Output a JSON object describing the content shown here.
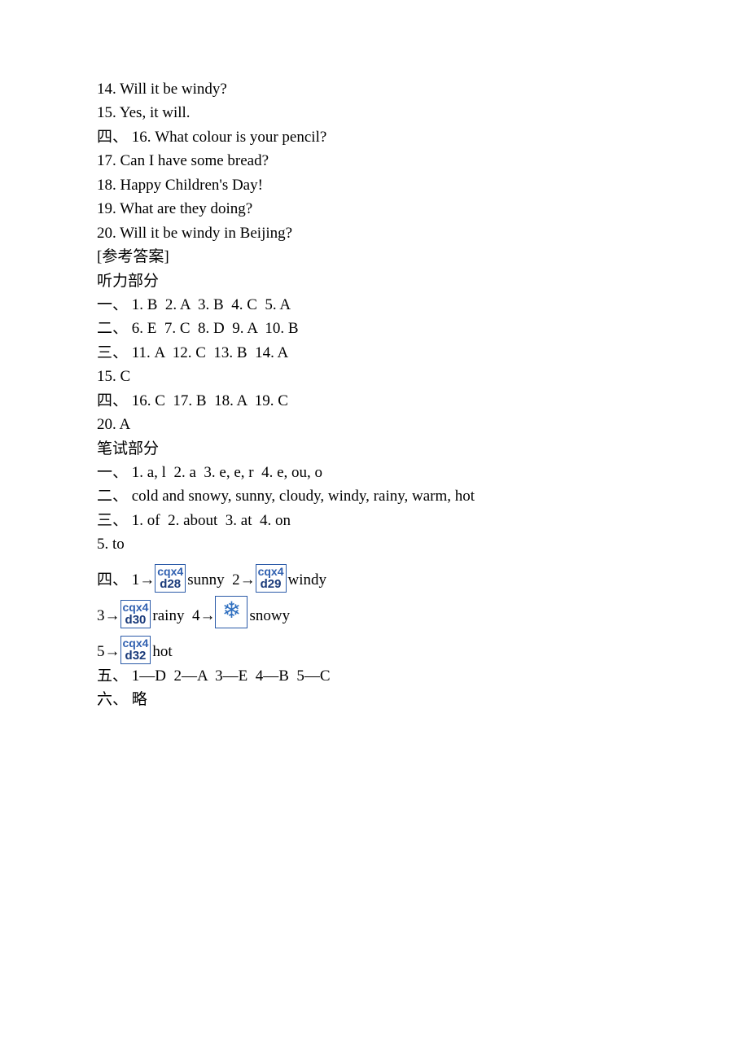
{
  "lines": {
    "l1": "14. Will it be windy?",
    "l2": "15. Yes, it will.",
    "l3": "四、 16. What colour is your pencil?",
    "l4": "17. Can I have some bread?",
    "l5": "18. Happy Children's Day!",
    "l6": "19. What are they doing?",
    "l7": "20. Will it be windy in Beijing?",
    "l8": "[参考答案]",
    "l9": "听力部分",
    "l10": "一、 1. B  2. A  3. B  4. C  5. A",
    "l11": "二、 6. E  7. C  8. D  9. A  10. B",
    "l12": "三、 11. A  12. C  13. B  14. A",
    "l13": "15. C",
    "l14": "四、 16. C  17. B  18. A  19. C",
    "l15": "20. A",
    "l16": "笔试部分",
    "l17": "一、 1. a, l  2. a  3. e, e, r  4. e, ou, o",
    "l18": "二、 cold and snowy, sunny, cloudy, windy, rainy, warm, hot",
    "l19": "三、 1. of  2. about  3. at  4. on",
    "l20": "5. to",
    "l21": "四、 1→",
    "l22": "sunny  2→",
    "l23": "windy",
    "l24": "3→",
    "l25": "rainy  4→",
    "l26": "snowy",
    "l27": "5→",
    "l28": "hot",
    "l29": "五、 1—D  2—A  3—E  4—B  5—C",
    "l30": "六、 略"
  },
  "placeholders": {
    "p1": {
      "top": "cqx4",
      "bot": "d28"
    },
    "p2": {
      "top": "cqx4",
      "bot": "d29"
    },
    "p3": {
      "top": "cqx4",
      "bot": "d30"
    },
    "p4": {
      "top": "cqx4",
      "bot": "d32"
    }
  }
}
